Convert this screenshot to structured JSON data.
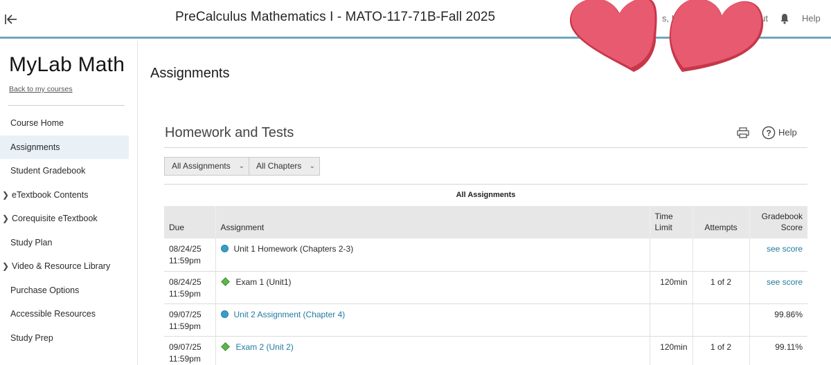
{
  "header": {
    "course_title": "PreCalculus Mathematics I - MATO-117-71B-Fall 2025",
    "user_fragment": "s, K",
    "signout_fragment": "Out",
    "help_label": "Help"
  },
  "sidebar": {
    "brand": "MyLab Math",
    "back_link": "Back to my courses",
    "items": [
      {
        "label": "Course Home"
      },
      {
        "label": "Assignments"
      },
      {
        "label": "Student Gradebook"
      },
      {
        "label": "eTextbook Contents"
      },
      {
        "label": "Corequisite eTextbook"
      },
      {
        "label": "Study Plan"
      },
      {
        "label": "Video & Resource Library"
      },
      {
        "label": "Purchase Options"
      },
      {
        "label": "Accessible Resources"
      },
      {
        "label": "Study Prep"
      }
    ]
  },
  "main": {
    "page_title": "Assignments",
    "section_title": "Homework and Tests",
    "help_label": "Help",
    "filters": {
      "assignments": "All Assignments",
      "chapters": "All Chapters"
    },
    "table_caption": "All Assignments",
    "columns": {
      "due": "Due",
      "assignment": "Assignment",
      "time_limit_1": "Time",
      "time_limit_2": "Limit",
      "attempts": "Attempts",
      "score_1": "Gradebook",
      "score_2": "Score"
    },
    "rows": [
      {
        "due_date": "08/24/25",
        "due_time": "11:59pm",
        "name": "Unit 1 Homework (Chapters 2-3)",
        "time_limit": "",
        "attempts": "",
        "score": "see score"
      },
      {
        "due_date": "08/24/25",
        "due_time": "11:59pm",
        "name": "Exam 1 (Unit1)",
        "time_limit": "120min",
        "attempts": "1 of 2",
        "score": "see score"
      },
      {
        "due_date": "09/07/25",
        "due_time": "11:59pm",
        "name": "Unit 2 Assignment (Chapter 4)",
        "time_limit": "",
        "attempts": "",
        "score": "99.86%"
      },
      {
        "due_date": "09/07/25",
        "due_time": "11:59pm",
        "name": "Exam 2 (Unit 2)",
        "time_limit": "120min",
        "attempts": "1 of 2",
        "score": "99.11%"
      }
    ]
  },
  "colors": {
    "accent_border": "#6fa6c0",
    "link": "#1f7aa0",
    "homework_dot": "#3a9dc6",
    "test_diamond": "#5fb54a",
    "heart": "#e85a6f",
    "active_nav_bg": "#e9f1f7"
  },
  "icons": {
    "collapse": "collapse-sidebar-icon",
    "bell": "bell-icon",
    "print": "print-icon",
    "help": "help-circle-icon",
    "homework": "homework-dot-icon",
    "test": "test-diamond-icon",
    "chevron": "chevron-right-icon",
    "caret": "chevron-down-icon",
    "sticker": "heart-sticker"
  }
}
